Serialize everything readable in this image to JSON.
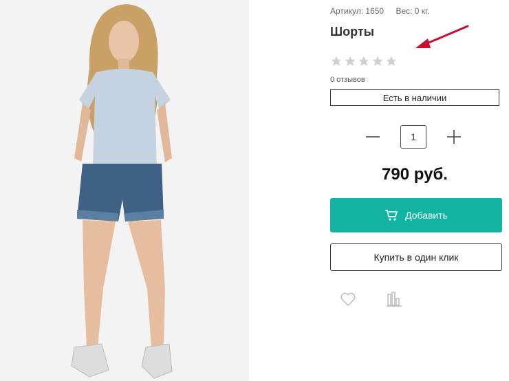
{
  "product": {
    "sku_label": "Артикул: 1650",
    "weight_label": "Вес: 0 кг.",
    "title": "Шорты",
    "rating_stars": 0,
    "reviews_label": "0 отзывов",
    "stock_label": "Есть в наличии",
    "quantity": "1",
    "price": "790 руб.",
    "add_label": "Добавить",
    "one_click_label": "Купить в один клик"
  },
  "colors": {
    "accent": "#12b3a0",
    "arrow": "#c8102e",
    "star": "#cfcfcf"
  },
  "icons": {
    "cart": "cart-icon",
    "wish": "heart-icon",
    "compare": "compare-icon",
    "minus": "minus-icon",
    "plus": "plus-icon",
    "arrow": "arrow-annotation"
  }
}
